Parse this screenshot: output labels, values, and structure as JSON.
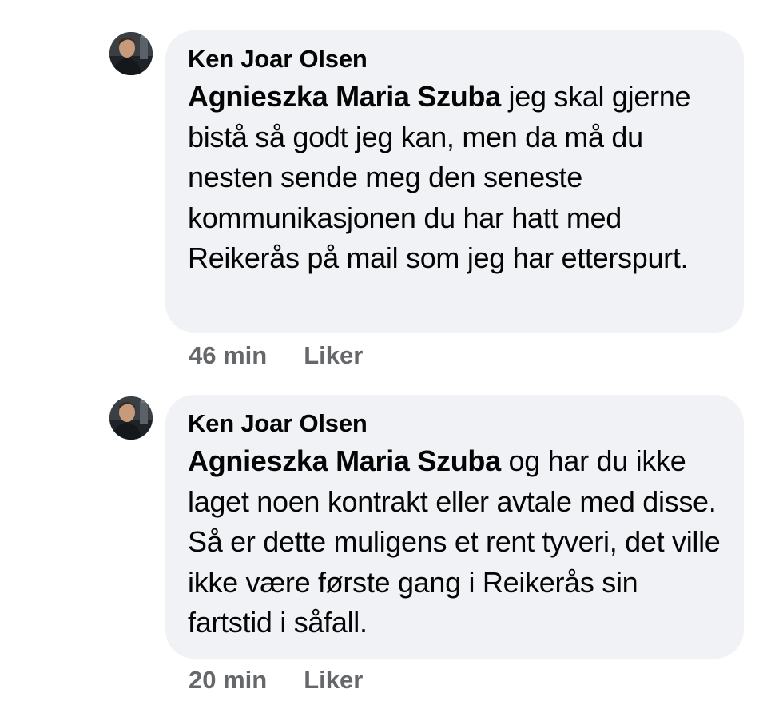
{
  "comments": [
    {
      "author": "Ken Joar Olsen",
      "mention": "Agnieszka Maria Szuba",
      "text": " jeg skal gjerne bistå så godt jeg kan, men da må du nesten sende meg den seneste kommunikasjonen du har hatt med Reikerås på mail som jeg har etterspurt.",
      "time": "46 min",
      "like_label": "Liker",
      "avatar_icon": "profile-photo"
    },
    {
      "author": "Ken Joar Olsen",
      "mention": "Agnieszka Maria Szuba",
      "text": " og har du ikke laget noen kontrakt eller avtale med disse. Så er dette muligens et rent tyveri, det ville ikke være første gang i Reikerås sin fartstid i såfall.",
      "time": "20 min",
      "like_label": "Liker",
      "avatar_icon": "profile-photo"
    }
  ],
  "colors": {
    "bubble": "#f0f2f5",
    "text": "#050505",
    "meta": "#65676b",
    "background": "#ffffff"
  }
}
